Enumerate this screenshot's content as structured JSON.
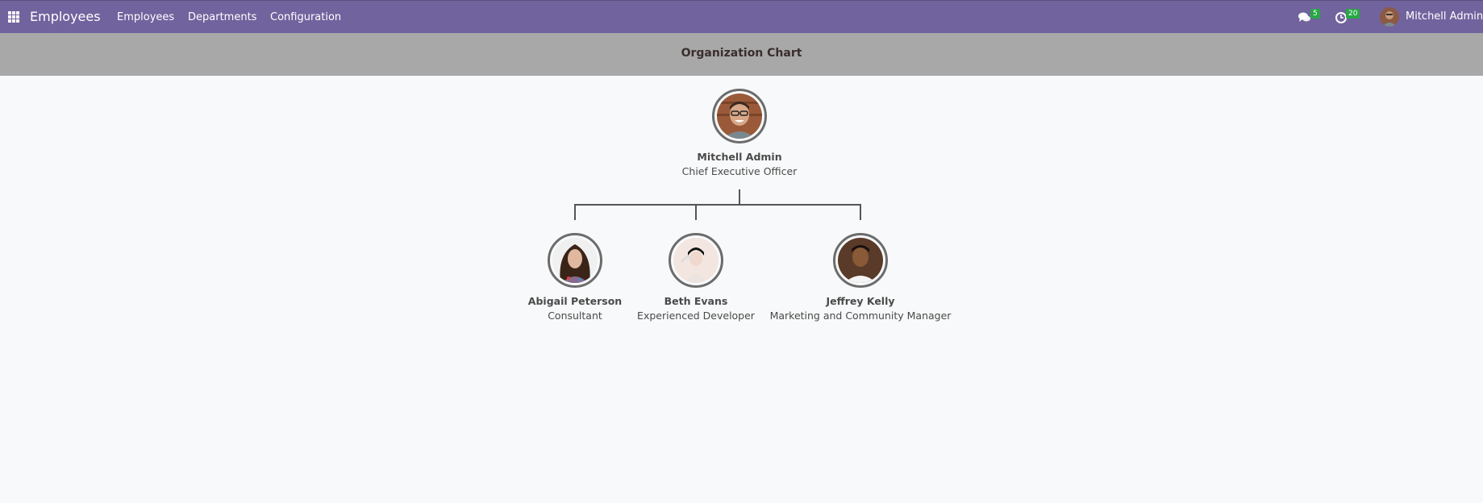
{
  "navbar": {
    "apps_icon": "grid-icon",
    "brand": "Employees",
    "menus": [
      "Employees",
      "Departments",
      "Configuration"
    ],
    "messages": {
      "icon": "chat-bubbles-icon",
      "count": "5"
    },
    "activities": {
      "icon": "clock-icon",
      "count": "20"
    },
    "user": {
      "name": "Mitchell Admin",
      "avatar": "user-avatar"
    }
  },
  "control_panel": {
    "title": "Organization Chart"
  },
  "org_chart": {
    "manager": {
      "name": "Mitchell Admin",
      "job": "Chief Executive Officer"
    },
    "subordinates": [
      {
        "name": "Abigail Peterson",
        "job": "Consultant"
      },
      {
        "name": "Beth Evans",
        "job": "Experienced Developer"
      },
      {
        "name": "Jeffrey Kelly",
        "job": "Marketing and Community Manager"
      }
    ]
  },
  "colors": {
    "navbar": "#71639e",
    "control_panel": "#a8a8a8",
    "badge": "#28a745",
    "connector": "#555555"
  }
}
